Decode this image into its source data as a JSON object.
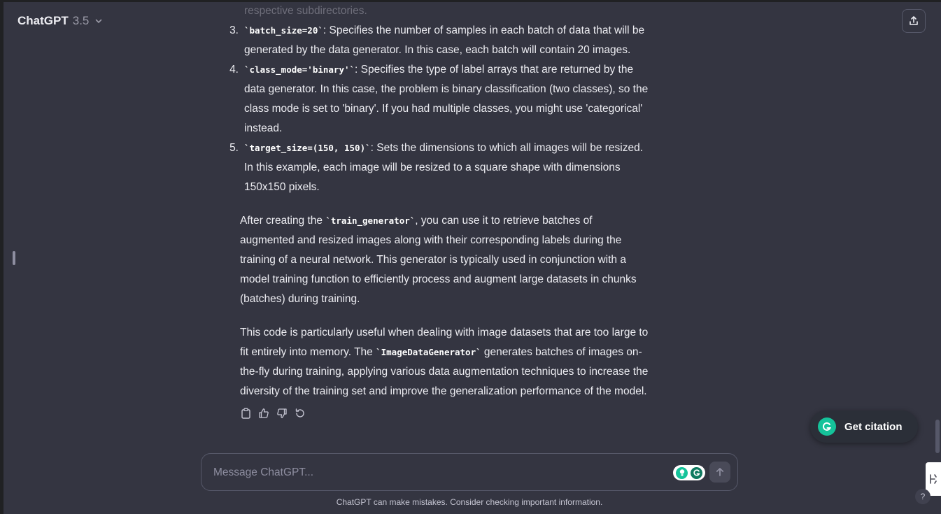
{
  "header": {
    "title": "ChatGPT",
    "version": "3.5"
  },
  "message": {
    "faded_line": "respective subdirectories.",
    "items": [
      {
        "number": "3.",
        "code": "`batch_size=20`",
        "text": ": Specifies the number of samples in each batch of data that will be",
        "line2": "generated by the data generator. In this case, each batch will contain 20 images."
      },
      {
        "number": "4.",
        "code": "`class_mode='binary'`",
        "text": ": Specifies the type of label arrays that are returned by the",
        "line2": "data generator. In this case, the problem is binary classification (two classes), so the",
        "line3": "class mode is set to 'binary'. If you had multiple classes, you might use 'categorical'",
        "line4": "instead."
      },
      {
        "number": "5.",
        "code": "`target_size=(150, 150)`",
        "text": ": Sets the dimensions to which all images will be resized.",
        "line2": "In this example, each image will be resized to a square shape with dimensions",
        "line3": "150x150 pixels."
      }
    ],
    "para1": {
      "pre": "After creating the ",
      "code": "`train_generator`",
      "post": ", you can use it to retrieve batches of",
      "lines": [
        "augmented and resized images along with their corresponding labels during the",
        "training of a neural network. This generator is typically used in conjunction with a",
        "model training function to efficiently process and augment large datasets in chunks",
        "(batches) during training."
      ]
    },
    "para2": {
      "line1": "This code is particularly useful when dealing with image datasets that are too large to",
      "pre": "fit entirely into memory. The ",
      "code": "`ImageDataGenerator`",
      "post": " generates batches of images on-",
      "lines": [
        "the-fly during training, applying various data augmentation techniques to increase the",
        "diversity of the training set and improve the generalization performance of the model."
      ]
    }
  },
  "actions": {
    "copy": "clipboard-icon",
    "like": "thumbs-up-icon",
    "dislike": "thumbs-down-icon",
    "regenerate": "refresh-icon"
  },
  "citation": {
    "label": "Get citation"
  },
  "composer": {
    "placeholder": "Message ChatGPT..."
  },
  "footer": {
    "disclaimer": "ChatGPT can make mistakes. Consider checking important information."
  },
  "help": {
    "label": "?"
  },
  "colors": {
    "background": "#343541",
    "grammarly_green": "#15c39a",
    "text": "#ececf1"
  }
}
